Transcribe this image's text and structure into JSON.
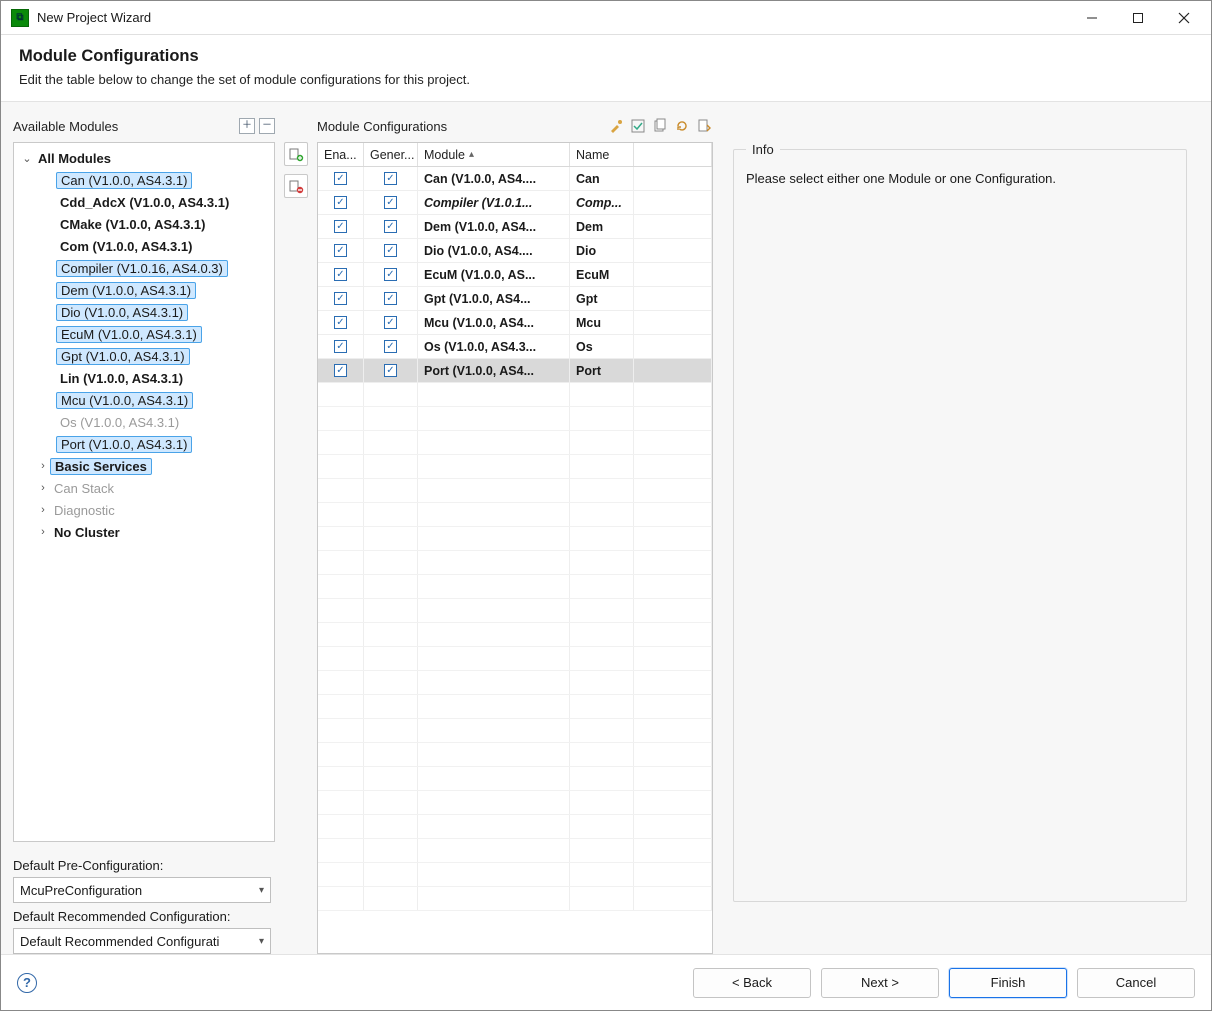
{
  "window": {
    "title": "New Project Wizard",
    "app_icon_label": "app-icon"
  },
  "header": {
    "title": "Module Configurations",
    "subtitle": "Edit the table below to change the set of module configurations for this project."
  },
  "left": {
    "section_label": "Available Modules",
    "expand_all_tooltip": "Expand All",
    "collapse_all_tooltip": "Collapse All",
    "tree": {
      "root": {
        "label": "All Modules",
        "expanded": true
      },
      "items": [
        {
          "label": "Can (V1.0.0, AS4.3.1)",
          "highlight": true,
          "bold": false,
          "dim": false
        },
        {
          "label": "Cdd_AdcX (V1.0.0, AS4.3.1)",
          "highlight": false,
          "bold": true,
          "dim": false
        },
        {
          "label": "CMake (V1.0.0, AS4.3.1)",
          "highlight": false,
          "bold": true,
          "dim": false
        },
        {
          "label": "Com (V1.0.0, AS4.3.1)",
          "highlight": false,
          "bold": true,
          "dim": false
        },
        {
          "label": "Compiler (V1.0.16, AS4.0.3)",
          "highlight": true,
          "bold": false,
          "dim": false
        },
        {
          "label": "Dem (V1.0.0, AS4.3.1)",
          "highlight": true,
          "bold": false,
          "dim": false
        },
        {
          "label": "Dio (V1.0.0, AS4.3.1)",
          "highlight": true,
          "bold": false,
          "dim": false
        },
        {
          "label": "EcuM (V1.0.0, AS4.3.1)",
          "highlight": true,
          "bold": false,
          "dim": false
        },
        {
          "label": "Gpt (V1.0.0, AS4.3.1)",
          "highlight": true,
          "bold": false,
          "dim": false
        },
        {
          "label": "Lin (V1.0.0, AS4.3.1)",
          "highlight": false,
          "bold": true,
          "dim": false
        },
        {
          "label": "Mcu (V1.0.0, AS4.3.1)",
          "highlight": true,
          "bold": false,
          "dim": false
        },
        {
          "label": "Os (V1.0.0, AS4.3.1)",
          "highlight": false,
          "bold": false,
          "dim": true
        },
        {
          "label": "Port (V1.0.0, AS4.3.1)",
          "highlight": true,
          "bold": false,
          "dim": false
        }
      ],
      "groups": [
        {
          "label": "Basic Services",
          "highlight": true,
          "bold": true
        },
        {
          "label": "Can Stack",
          "highlight": false,
          "bold": false,
          "dim": true
        },
        {
          "label": "Diagnostic",
          "highlight": false,
          "bold": false,
          "dim": true
        },
        {
          "label": "No Cluster",
          "highlight": false,
          "bold": true
        }
      ]
    },
    "pre_config_label": "Default Pre-Configuration:",
    "pre_config_value": "McuPreConfiguration",
    "rec_config_label": "Default Recommended Configuration:",
    "rec_config_value": "Default Recommended Configurati"
  },
  "mid_buttons": {
    "add_tooltip": "Add module configuration",
    "remove_tooltip": "Remove module configuration"
  },
  "table": {
    "section_label": "Module Configurations",
    "columns": {
      "enable": "Ena...",
      "generate": "Gener...",
      "module": "Module",
      "name": "Name"
    },
    "sort_column": "module",
    "rows": [
      {
        "enable": true,
        "generate": true,
        "module": "Can (V1.0.0, AS4....",
        "name": "Can",
        "italic": false,
        "selected": false
      },
      {
        "enable": true,
        "generate": true,
        "module": "Compiler (V1.0.1...",
        "name": "Comp...",
        "italic": true,
        "selected": false
      },
      {
        "enable": true,
        "generate": true,
        "module": "Dem (V1.0.0, AS4...",
        "name": "Dem",
        "italic": false,
        "selected": false
      },
      {
        "enable": true,
        "generate": true,
        "module": "Dio (V1.0.0, AS4....",
        "name": "Dio",
        "italic": false,
        "selected": false
      },
      {
        "enable": true,
        "generate": true,
        "module": "EcuM (V1.0.0, AS...",
        "name": "EcuM",
        "italic": false,
        "selected": false
      },
      {
        "enable": true,
        "generate": true,
        "module": "Gpt (V1.0.0, AS4...",
        "name": "Gpt",
        "italic": false,
        "selected": false
      },
      {
        "enable": true,
        "generate": true,
        "module": "Mcu (V1.0.0, AS4...",
        "name": "Mcu",
        "italic": false,
        "selected": false
      },
      {
        "enable": true,
        "generate": true,
        "module": "Os (V1.0.0, AS4.3...",
        "name": "Os",
        "italic": false,
        "selected": false
      },
      {
        "enable": true,
        "generate": true,
        "module": "Port (V1.0.0, AS4...",
        "name": "Port",
        "italic": false,
        "selected": true
      }
    ],
    "empty_rows": 22
  },
  "info": {
    "legend": "Info",
    "text": "Please select either one Module or one Configuration."
  },
  "footer": {
    "back": "< Back",
    "next": "Next >",
    "finish": "Finish",
    "cancel": "Cancel"
  }
}
